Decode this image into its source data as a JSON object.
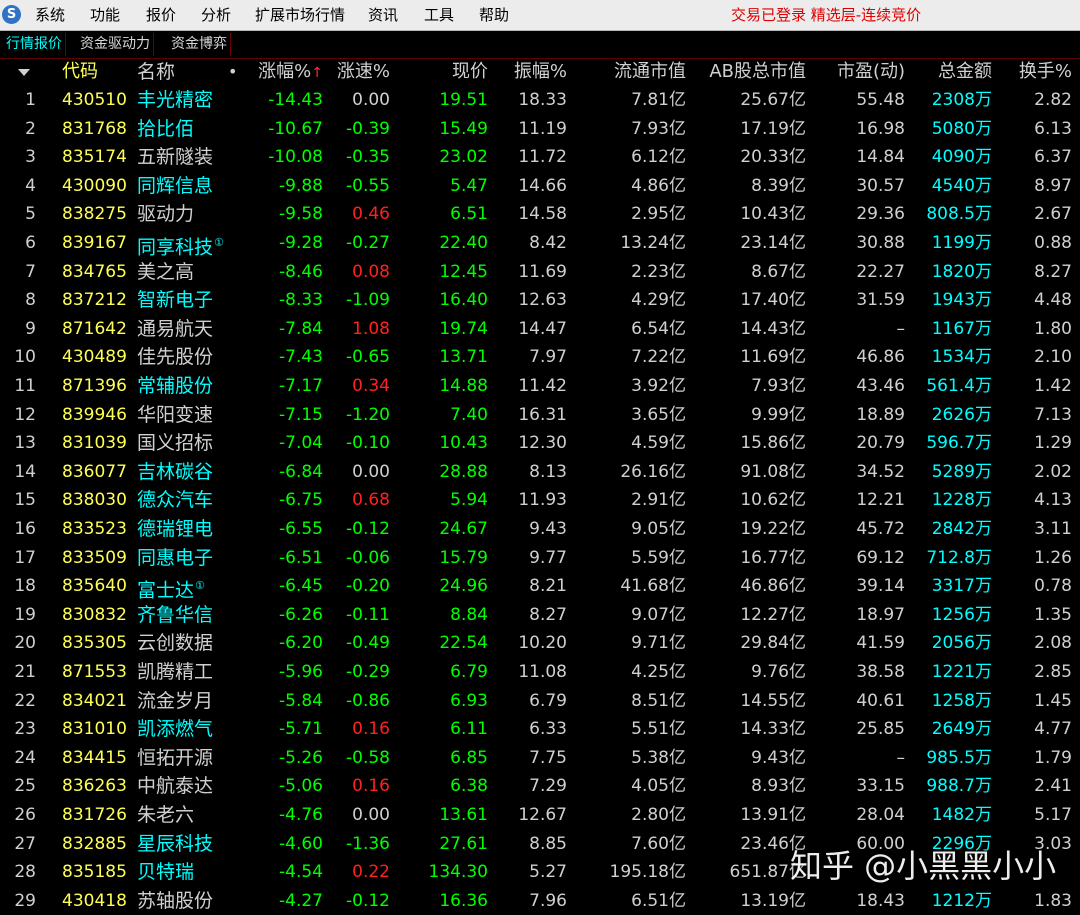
{
  "menubar": {
    "logo": "S",
    "items": [
      "系统",
      "功能",
      "报价",
      "分析",
      "扩展市场行情",
      "资讯",
      "工具",
      "帮助"
    ],
    "status": "交易已登录  精选层-连续竞价"
  },
  "tabs": [
    "行情报价",
    "资金驱动力",
    "资金博弈"
  ],
  "columns": {
    "code": "代码",
    "name": "名称",
    "dot": "•",
    "change": "涨幅%",
    "sort_mark": "↑",
    "speed": "涨速%",
    "price": "现价",
    "amplitude": "振幅%",
    "float_cap": "流通市值",
    "ab_cap": "AB股总市值",
    "pe": "市盈(动)",
    "amount": "总金额",
    "turnover": "换手%"
  },
  "colors": {
    "green": "#00ff00",
    "red": "#ff2020",
    "white": "#d0d0d0",
    "cyan": "#00ffff",
    "yellow": "#ffff55",
    "status_red": "#e00000"
  },
  "rows": [
    {
      "idx": "1",
      "code": "430510",
      "name": "丰光精密",
      "nameColor": "cyan",
      "sup": "",
      "change": "-14.43",
      "speed": "0.00",
      "speedColor": "white",
      "price": "19.51",
      "amp": "18.33",
      "float": "7.81亿",
      "ab": "25.67亿",
      "pe": "55.48",
      "amt": "2308万",
      "turn": "2.82"
    },
    {
      "idx": "2",
      "code": "831768",
      "name": "拾比佰",
      "nameColor": "cyan",
      "sup": "",
      "change": "-10.67",
      "speed": "-0.39",
      "speedColor": "green",
      "price": "15.49",
      "amp": "11.19",
      "float": "7.93亿",
      "ab": "17.19亿",
      "pe": "16.98",
      "amt": "5080万",
      "turn": "6.13"
    },
    {
      "idx": "3",
      "code": "835174",
      "name": "五新隧装",
      "nameColor": "white",
      "sup": "",
      "change": "-10.08",
      "speed": "-0.35",
      "speedColor": "green",
      "price": "23.02",
      "amp": "11.72",
      "float": "6.12亿",
      "ab": "20.33亿",
      "pe": "14.84",
      "amt": "4090万",
      "turn": "6.37"
    },
    {
      "idx": "4",
      "code": "430090",
      "name": "同辉信息",
      "nameColor": "cyan",
      "sup": "",
      "change": "-9.88",
      "speed": "-0.55",
      "speedColor": "green",
      "price": "5.47",
      "amp": "14.66",
      "float": "4.86亿",
      "ab": "8.39亿",
      "pe": "30.57",
      "amt": "4540万",
      "turn": "8.97"
    },
    {
      "idx": "5",
      "code": "838275",
      "name": "驱动力",
      "nameColor": "white",
      "sup": "",
      "change": "-9.58",
      "speed": "0.46",
      "speedColor": "red",
      "price": "6.51",
      "amp": "14.58",
      "float": "2.95亿",
      "ab": "10.43亿",
      "pe": "29.36",
      "amt": "808.5万",
      "turn": "2.67"
    },
    {
      "idx": "6",
      "code": "839167",
      "name": "同享科技",
      "nameColor": "cyan",
      "sup": "①",
      "change": "-9.28",
      "speed": "-0.27",
      "speedColor": "green",
      "price": "22.40",
      "amp": "8.42",
      "float": "13.24亿",
      "ab": "23.14亿",
      "pe": "30.88",
      "amt": "1199万",
      "turn": "0.88"
    },
    {
      "idx": "7",
      "code": "834765",
      "name": "美之高",
      "nameColor": "white",
      "sup": "",
      "change": "-8.46",
      "speed": "0.08",
      "speedColor": "red",
      "price": "12.45",
      "amp": "11.69",
      "float": "2.23亿",
      "ab": "8.67亿",
      "pe": "22.27",
      "amt": "1820万",
      "turn": "8.27"
    },
    {
      "idx": "8",
      "code": "837212",
      "name": "智新电子",
      "nameColor": "cyan",
      "sup": "",
      "change": "-8.33",
      "speed": "-1.09",
      "speedColor": "green",
      "price": "16.40",
      "amp": "12.63",
      "float": "4.29亿",
      "ab": "17.40亿",
      "pe": "31.59",
      "amt": "1943万",
      "turn": "4.48"
    },
    {
      "idx": "9",
      "code": "871642",
      "name": "通易航天",
      "nameColor": "white",
      "sup": "",
      "change": "-7.84",
      "speed": "1.08",
      "speedColor": "red",
      "price": "19.74",
      "amp": "14.47",
      "float": "6.54亿",
      "ab": "14.43亿",
      "pe": "–",
      "amt": "1167万",
      "turn": "1.80"
    },
    {
      "idx": "10",
      "code": "430489",
      "name": "佳先股份",
      "nameColor": "white",
      "sup": "",
      "change": "-7.43",
      "speed": "-0.65",
      "speedColor": "green",
      "price": "13.71",
      "amp": "7.97",
      "float": "7.22亿",
      "ab": "11.69亿",
      "pe": "46.86",
      "amt": "1534万",
      "turn": "2.10"
    },
    {
      "idx": "11",
      "code": "871396",
      "name": "常辅股份",
      "nameColor": "cyan",
      "sup": "",
      "change": "-7.17",
      "speed": "0.34",
      "speedColor": "red",
      "price": "14.88",
      "amp": "11.42",
      "float": "3.92亿",
      "ab": "7.93亿",
      "pe": "43.46",
      "amt": "561.4万",
      "turn": "1.42"
    },
    {
      "idx": "12",
      "code": "839946",
      "name": "华阳变速",
      "nameColor": "white",
      "sup": "",
      "change": "-7.15",
      "speed": "-1.20",
      "speedColor": "green",
      "price": "7.40",
      "amp": "16.31",
      "float": "3.65亿",
      "ab": "9.99亿",
      "pe": "18.89",
      "amt": "2626万",
      "turn": "7.13"
    },
    {
      "idx": "13",
      "code": "831039",
      "name": "国义招标",
      "nameColor": "white",
      "sup": "",
      "change": "-7.04",
      "speed": "-0.10",
      "speedColor": "green",
      "price": "10.43",
      "amp": "12.30",
      "float": "4.59亿",
      "ab": "15.86亿",
      "pe": "20.79",
      "amt": "596.7万",
      "turn": "1.29"
    },
    {
      "idx": "14",
      "code": "836077",
      "name": "吉林碳谷",
      "nameColor": "cyan",
      "sup": "",
      "change": "-6.84",
      "speed": "0.00",
      "speedColor": "white",
      "price": "28.88",
      "amp": "8.13",
      "float": "26.16亿",
      "ab": "91.08亿",
      "pe": "34.52",
      "amt": "5289万",
      "turn": "2.02"
    },
    {
      "idx": "15",
      "code": "838030",
      "name": "德众汽车",
      "nameColor": "cyan",
      "sup": "",
      "change": "-6.75",
      "speed": "0.68",
      "speedColor": "red",
      "price": "5.94",
      "amp": "11.93",
      "float": "2.91亿",
      "ab": "10.62亿",
      "pe": "12.21",
      "amt": "1228万",
      "turn": "4.13"
    },
    {
      "idx": "16",
      "code": "833523",
      "name": "德瑞锂电",
      "nameColor": "cyan",
      "sup": "",
      "change": "-6.55",
      "speed": "-0.12",
      "speedColor": "green",
      "price": "24.67",
      "amp": "9.43",
      "float": "9.05亿",
      "ab": "19.22亿",
      "pe": "45.72",
      "amt": "2842万",
      "turn": "3.11"
    },
    {
      "idx": "17",
      "code": "833509",
      "name": "同惠电子",
      "nameColor": "cyan",
      "sup": "",
      "change": "-6.51",
      "speed": "-0.06",
      "speedColor": "green",
      "price": "15.79",
      "amp": "9.77",
      "float": "5.59亿",
      "ab": "16.77亿",
      "pe": "69.12",
      "amt": "712.8万",
      "turn": "1.26"
    },
    {
      "idx": "18",
      "code": "835640",
      "name": "富士达",
      "nameColor": "cyan",
      "sup": "①",
      "change": "-6.45",
      "speed": "-0.20",
      "speedColor": "green",
      "price": "24.96",
      "amp": "8.21",
      "float": "41.68亿",
      "ab": "46.86亿",
      "pe": "39.14",
      "amt": "3317万",
      "turn": "0.78"
    },
    {
      "idx": "19",
      "code": "830832",
      "name": "齐鲁华信",
      "nameColor": "cyan",
      "sup": "",
      "change": "-6.26",
      "speed": "-0.11",
      "speedColor": "green",
      "price": "8.84",
      "amp": "8.27",
      "float": "9.07亿",
      "ab": "12.27亿",
      "pe": "18.97",
      "amt": "1256万",
      "turn": "1.35"
    },
    {
      "idx": "20",
      "code": "835305",
      "name": "云创数据",
      "nameColor": "white",
      "sup": "",
      "change": "-6.20",
      "speed": "-0.49",
      "speedColor": "green",
      "price": "22.54",
      "amp": "10.20",
      "float": "9.71亿",
      "ab": "29.84亿",
      "pe": "41.59",
      "amt": "2056万",
      "turn": "2.08"
    },
    {
      "idx": "21",
      "code": "871553",
      "name": "凯腾精工",
      "nameColor": "white",
      "sup": "",
      "change": "-5.96",
      "speed": "-0.29",
      "speedColor": "green",
      "price": "6.79",
      "amp": "11.08",
      "float": "4.25亿",
      "ab": "9.76亿",
      "pe": "38.58",
      "amt": "1221万",
      "turn": "2.85"
    },
    {
      "idx": "22",
      "code": "834021",
      "name": "流金岁月",
      "nameColor": "white",
      "sup": "",
      "change": "-5.84",
      "speed": "-0.86",
      "speedColor": "green",
      "price": "6.93",
      "amp": "6.79",
      "float": "8.51亿",
      "ab": "14.55亿",
      "pe": "40.61",
      "amt": "1258万",
      "turn": "1.45"
    },
    {
      "idx": "23",
      "code": "831010",
      "name": "凯添燃气",
      "nameColor": "cyan",
      "sup": "",
      "change": "-5.71",
      "speed": "0.16",
      "speedColor": "red",
      "price": "6.11",
      "amp": "6.33",
      "float": "5.51亿",
      "ab": "14.33亿",
      "pe": "25.85",
      "amt": "2649万",
      "turn": "4.77"
    },
    {
      "idx": "24",
      "code": "834415",
      "name": "恒拓开源",
      "nameColor": "white",
      "sup": "",
      "change": "-5.26",
      "speed": "-0.58",
      "speedColor": "green",
      "price": "6.85",
      "amp": "7.75",
      "float": "5.38亿",
      "ab": "9.43亿",
      "pe": "–",
      "amt": "985.5万",
      "turn": "1.79"
    },
    {
      "idx": "25",
      "code": "836263",
      "name": "中航泰达",
      "nameColor": "white",
      "sup": "",
      "change": "-5.06",
      "speed": "0.16",
      "speedColor": "red",
      "price": "6.38",
      "amp": "7.29",
      "float": "4.05亿",
      "ab": "8.93亿",
      "pe": "33.15",
      "amt": "988.7万",
      "turn": "2.41"
    },
    {
      "idx": "26",
      "code": "831726",
      "name": "朱老六",
      "nameColor": "white",
      "sup": "",
      "change": "-4.76",
      "speed": "0.00",
      "speedColor": "white",
      "price": "13.61",
      "amp": "12.67",
      "float": "2.80亿",
      "ab": "13.91亿",
      "pe": "28.04",
      "amt": "1482万",
      "turn": "5.17"
    },
    {
      "idx": "27",
      "code": "832885",
      "name": "星辰科技",
      "nameColor": "cyan",
      "sup": "",
      "change": "-4.60",
      "speed": "-1.36",
      "speedColor": "green",
      "price": "27.61",
      "amp": "8.85",
      "float": "7.60亿",
      "ab": "23.46亿",
      "pe": "60.00",
      "amt": "2296万",
      "turn": "3.03"
    },
    {
      "idx": "28",
      "code": "835185",
      "name": "贝特瑞",
      "nameColor": "cyan",
      "sup": "",
      "change": "-4.54",
      "speed": "0.22",
      "speedColor": "red",
      "price": "134.30",
      "amp": "5.27",
      "float": "195.18亿",
      "ab": "651.87亿",
      "pe": "",
      "amt": "",
      "turn": ""
    },
    {
      "idx": "29",
      "code": "430418",
      "name": "苏轴股份",
      "nameColor": "white",
      "sup": "",
      "change": "-4.27",
      "speed": "-0.12",
      "speedColor": "green",
      "price": "16.36",
      "amp": "7.96",
      "float": "6.51亿",
      "ab": "13.19亿",
      "pe": "18.43",
      "amt": "1212万",
      "turn": "1.83"
    }
  ],
  "watermark": "知乎 @小黑黑小小"
}
